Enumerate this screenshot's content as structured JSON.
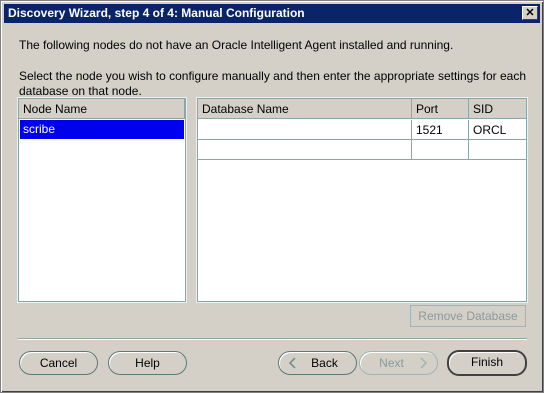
{
  "window": {
    "title": "Discovery Wizard, step 4 of 4: Manual Configuration",
    "close_glyph": "✕"
  },
  "intro": {
    "line1": "The following nodes do not have an Oracle Intelligent Agent installed and running.",
    "line2": "Select the node you wish to configure manually and then enter the appropriate settings for each database on that node."
  },
  "node_table": {
    "header": "Node Name",
    "rows": [
      "scribe"
    ]
  },
  "db_table": {
    "headers": [
      "Database Name",
      "Port",
      "SID"
    ],
    "rows": [
      [
        "",
        "1521",
        "ORCL"
      ],
      [
        "",
        "",
        ""
      ]
    ]
  },
  "buttons": {
    "remove_database": "Remove Database",
    "cancel": "Cancel",
    "help": "Help",
    "back": "Back",
    "next": "Next",
    "finish": "Finish"
  },
  "icons": {
    "back": "chevron-left-icon",
    "next": "chevron-right-icon",
    "close": "close-icon"
  },
  "colors": {
    "titlebar": "#0a246a",
    "selection": "#0000ee",
    "face": "#d4d0c8"
  }
}
